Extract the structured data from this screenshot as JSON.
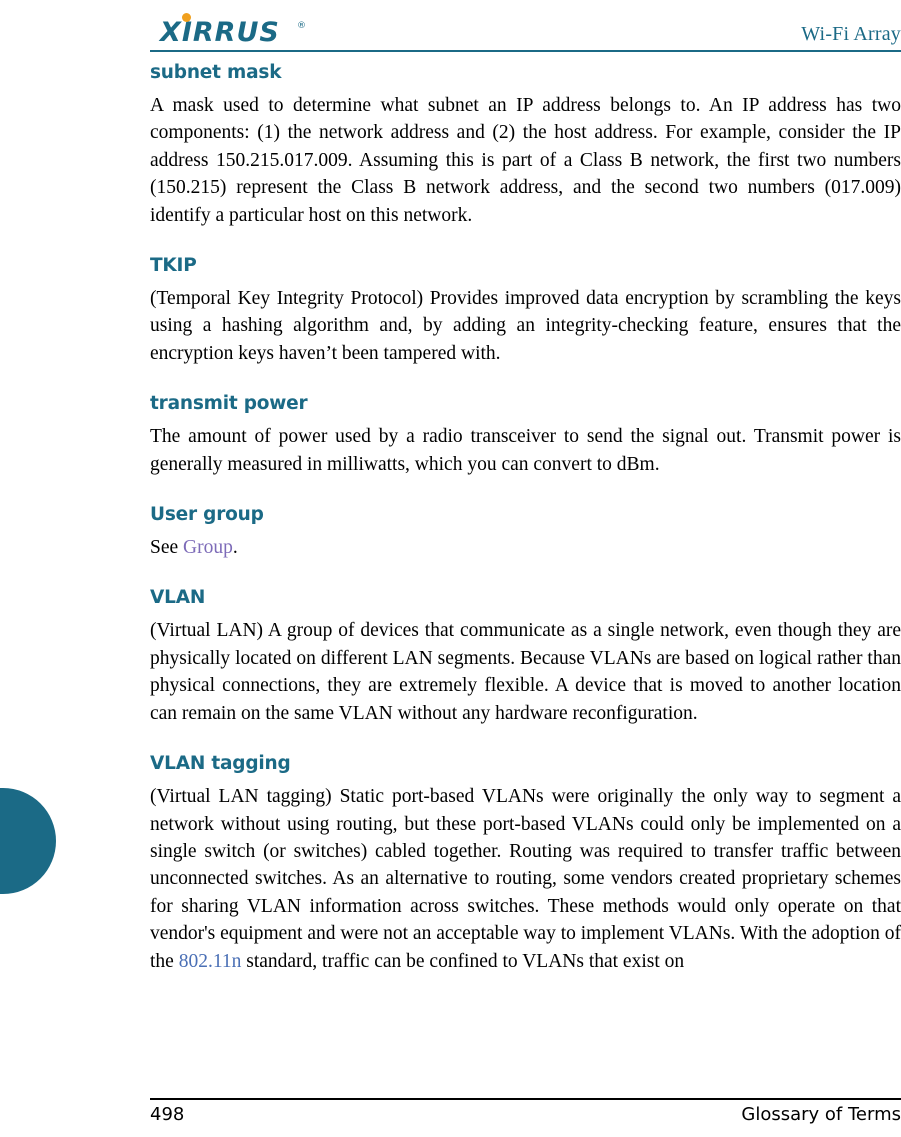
{
  "header": {
    "title": "Wi-Fi Array",
    "logo_text": "XIRRUS",
    "logo_registered": "®"
  },
  "glossary": {
    "entries": [
      {
        "term": "subnet mask",
        "term_style": "sans-bold-teal",
        "paragraphs": [
          "A mask used to determine what subnet an IP address belongs to. An IP address has two components: (1) the network address and (2) the host address. For example, consider the IP address 150.215.017.009. Assuming this is part of a Class B network, the first two numbers (150.215) represent the Class B network address, and the second two numbers (017.009) identify a particular host on this network."
        ]
      },
      {
        "term": "TKIP",
        "paragraphs": [
          "(Temporal Key Integrity Protocol) Provides improved data encryption by scrambling the keys using a hashing algorithm and, by adding an integrity-checking feature, ensures that the encryption keys haven’t been tampered with."
        ]
      },
      {
        "term": "transmit power",
        "paragraphs": [
          "The amount of power used by a radio transceiver to send the signal out. Transmit power is generally measured in milliwatts, which you can convert to dBm."
        ]
      },
      {
        "term": "User group",
        "see_prefix": "See ",
        "see_link": "Group",
        "see_suffix": "."
      },
      {
        "term": "VLAN",
        "paragraphs": [
          "(Virtual LAN) A group of devices that communicate as a single network, even though they are physically located on different LAN segments. Because VLANs are based on logical rather than physical connections, they are extremely flexible. A device that is moved to another location can remain on the same VLAN without any hardware reconfiguration."
        ]
      },
      {
        "term": "VLAN tagging",
        "paragraphs_pre_link": "(Virtual LAN tagging) Static port-based VLANs were originally the only way to segment a network without using routing, but these port-based VLANs could only be implemented on a single switch (or switches) cabled together. Routing was required to transfer traffic between unconnected switches. As an alternative to routing, some vendors created proprietary schemes for sharing VLAN information across switches. These methods would only operate on that vendor's equipment and were not an acceptable way to implement VLANs. With the adoption of the ",
        "link": "802.11n",
        "paragraphs_post_link": " standard, traffic can be confined to VLANs that exist on"
      }
    ]
  },
  "footer": {
    "page_number": "498",
    "section_label": "Glossary of Terms"
  },
  "colors": {
    "accent_teal": "#1b6a86",
    "logo_dot_orange": "#f0a01e",
    "xref_purple": "#7d6bb8",
    "xref_blue": "#4a6fb5"
  }
}
